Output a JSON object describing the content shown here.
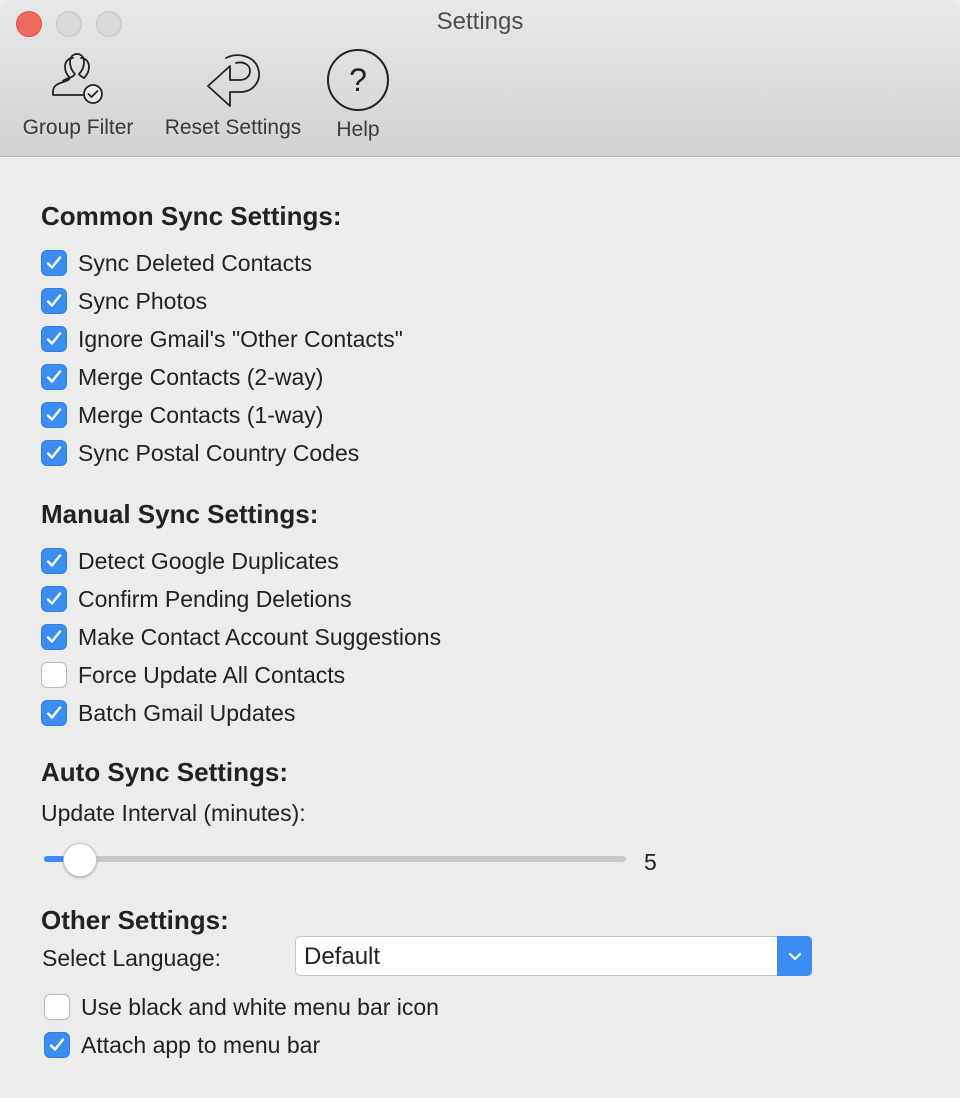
{
  "window": {
    "title": "Settings"
  },
  "toolbar": [
    {
      "label": "Group Filter",
      "icon": "group-filter-icon"
    },
    {
      "label": "Reset Settings",
      "icon": "reset-icon"
    },
    {
      "label": "Help",
      "icon": "help-icon"
    }
  ],
  "common_sync": {
    "title": "Common Sync Settings:",
    "items": [
      {
        "label": "Sync Deleted Contacts",
        "checked": true
      },
      {
        "label": "Sync Photos",
        "checked": true
      },
      {
        "label": "Ignore Gmail's \"Other Contacts\"",
        "checked": true
      },
      {
        "label": "Merge Contacts (2-way)",
        "checked": true
      },
      {
        "label": "Merge Contacts (1-way)",
        "checked": true
      },
      {
        "label": "Sync Postal Country Codes",
        "checked": true
      }
    ]
  },
  "manual_sync": {
    "title": "Manual Sync Settings:",
    "items": [
      {
        "label": "Detect Google Duplicates",
        "checked": true
      },
      {
        "label": "Confirm Pending Deletions",
        "checked": true
      },
      {
        "label": "Make Contact Account Suggestions",
        "checked": true
      },
      {
        "label": "Force Update All Contacts",
        "checked": false
      },
      {
        "label": "Batch Gmail Updates",
        "checked": true
      }
    ]
  },
  "auto_sync": {
    "title": "Auto Sync Settings:",
    "interval_label": "Update Interval (minutes):",
    "interval_value": "5",
    "interval_fraction": 0.06
  },
  "other": {
    "title": "Other Settings:",
    "language_label": "Select Language:",
    "language_value": "Default",
    "items": [
      {
        "label": "Use black and white menu bar icon",
        "checked": false
      },
      {
        "label": "Attach app to menu bar",
        "checked": true
      }
    ]
  },
  "colors": {
    "accent": "#3b8df2",
    "close_button": "#ee6a5e"
  }
}
